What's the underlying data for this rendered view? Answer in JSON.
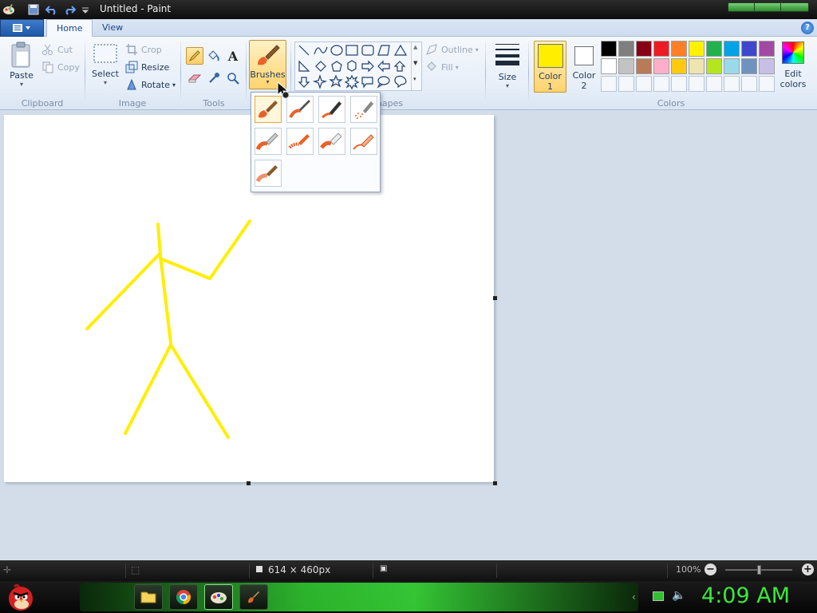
{
  "window": {
    "title": "Untitled - Paint"
  },
  "tabs": [
    {
      "label": "Home"
    },
    {
      "label": "View"
    }
  ],
  "help_label": "?",
  "clipboard": {
    "paste": "Paste",
    "cut": "Cut",
    "copy": "Copy",
    "group": "Clipboard"
  },
  "image": {
    "select": "Select",
    "crop": "Crop",
    "resize": "Resize",
    "rotate": "Rotate",
    "group": "Image"
  },
  "tools": {
    "group": "Tools",
    "text_tool": "A"
  },
  "brushes": {
    "label": "Brushes"
  },
  "shapes": {
    "outline": "Outline",
    "fill": "Fill",
    "group": "Shapes"
  },
  "size": {
    "label": "Size"
  },
  "colors": {
    "group": "Colors",
    "color1_label": "Color",
    "color1_num": "1",
    "color2_label": "Color",
    "color2_num": "2",
    "edit_label": "Edit",
    "edit_label2": "colors",
    "color1_value": "#ffee00",
    "color2_value": "#ffffff",
    "row1": [
      "#000000",
      "#7f7f7f",
      "#880015",
      "#ed1c24",
      "#ff7f27",
      "#fff200",
      "#22b14c",
      "#00a2e8",
      "#3f48cc",
      "#a349a4"
    ],
    "row2": [
      "#ffffff",
      "#c3c3c3",
      "#b97a57",
      "#ffaec9",
      "#ffc90e",
      "#efe4b0",
      "#b5e61d",
      "#99d9ea",
      "#7092be",
      "#c8bfe7"
    ]
  },
  "drawing": {
    "stroke_color": "#ffee00"
  },
  "status": {
    "canvas_size": "614 × 460px",
    "zoom": "100%"
  },
  "taskbar": {
    "clock": "4:09 AM"
  }
}
